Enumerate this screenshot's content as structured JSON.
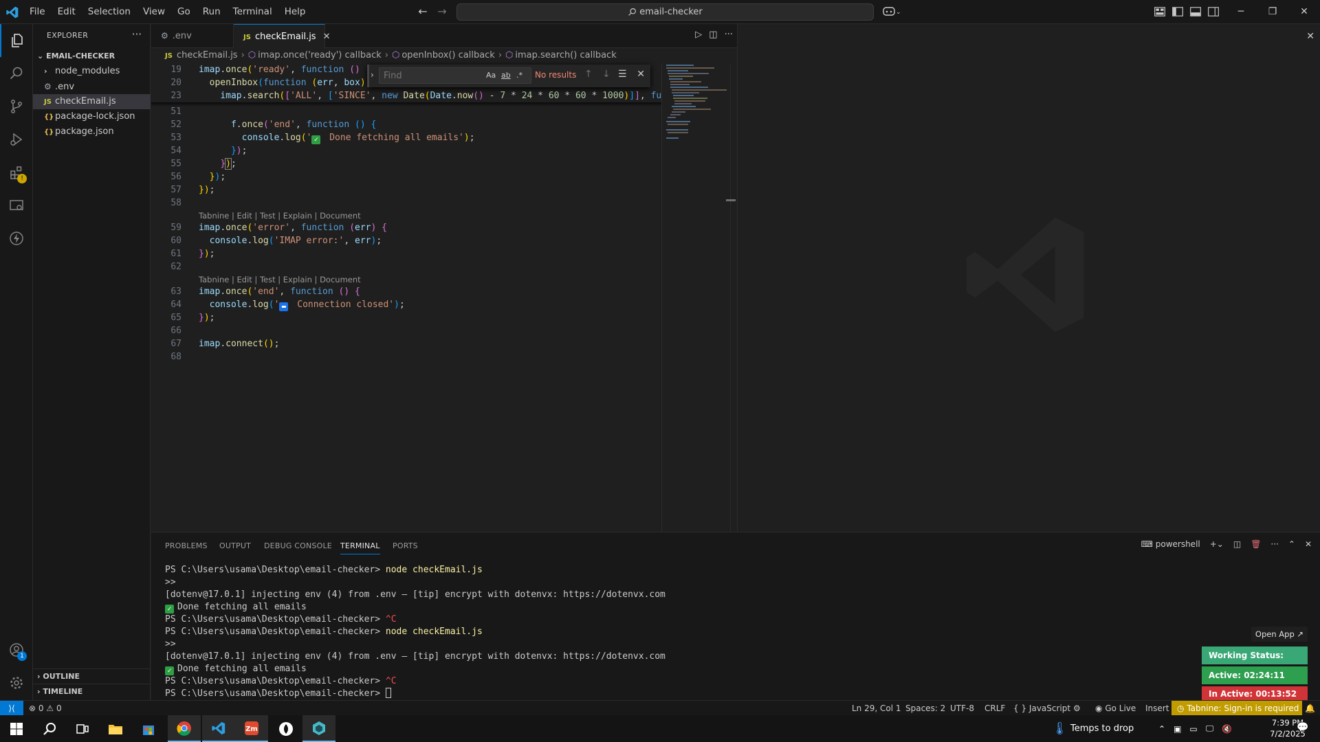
{
  "titlebar": {
    "menu": [
      "File",
      "Edit",
      "Selection",
      "View",
      "Go",
      "Run",
      "Terminal",
      "Help"
    ],
    "search_text": "email-checker"
  },
  "sidebar": {
    "title": "EXPLORER",
    "folder": "EMAIL-CHECKER",
    "items": [
      {
        "label": "node_modules",
        "type": "folder"
      },
      {
        "label": ".env",
        "type": "env"
      },
      {
        "label": "checkEmail.js",
        "type": "js"
      },
      {
        "label": "package-lock.json",
        "type": "json"
      },
      {
        "label": "package.json",
        "type": "json"
      }
    ],
    "outline": "OUTLINE",
    "timeline": "TIMELINE"
  },
  "tabs": [
    {
      "label": ".env",
      "icon": "gear-icon"
    },
    {
      "label": "checkEmail.js",
      "icon": "JS"
    }
  ],
  "breadcrumb": [
    "checkEmail.js",
    "imap.once('ready') callback",
    "openInbox() callback",
    "imap.search() callback"
  ],
  "find": {
    "placeholder": "Find",
    "case_label": "Aa",
    "word_label": "ab",
    "regex_label": ".*",
    "result": "No results"
  },
  "editor": {
    "sticky_numbers": [
      "19",
      "20",
      "23"
    ],
    "line_numbers": [
      "51",
      "52",
      "53",
      "54",
      "55",
      "56",
      "57",
      "58",
      "59",
      "60",
      "61",
      "62",
      "63",
      "64",
      "65",
      "66",
      "67",
      "68"
    ],
    "codelens": "Tabnine | Edit | Test | Explain | Document",
    "strings": {
      "ready": "'ready'",
      "all": "'ALL'",
      "since": "'SINCE'",
      "end": "'end'",
      "done": " Done fetching all emails'",
      "error": "'error'",
      "imap_error": "'IMAP error:'",
      "closed": " Connection closed'"
    },
    "numbers": [
      "7",
      "24",
      "60",
      "60",
      "1000"
    ]
  },
  "panel": {
    "tabs": [
      "PROBLEMS",
      "OUTPUT",
      "DEBUG CONSOLE",
      "TERMINAL",
      "PORTS"
    ],
    "shell": "powershell",
    "terminal": [
      {
        "prompt": "PS C:\\Users\\usama\\Desktop\\email-checker> ",
        "cmd": "node checkEmail.js"
      },
      {
        "text": ">>"
      },
      {
        "text": "[dotenv@17.0.1] injecting env (4) from .env – [tip] encrypt with dotenvx: https://dotenvx.com"
      },
      {
        "check": "Done fetching all emails"
      },
      {
        "prompt": "PS C:\\Users\\usama\\Desktop\\email-checker> ",
        "ctrl": "^C"
      },
      {
        "prompt": "PS C:\\Users\\usama\\Desktop\\email-checker> ",
        "cmd": "node checkEmail.js"
      },
      {
        "text": ">>"
      },
      {
        "text": "[dotenv@17.0.1] injecting env (4) from .env – [tip] encrypt with dotenvx: https://dotenvx.com"
      },
      {
        "check": "Done fetching all emails"
      },
      {
        "prompt": "PS C:\\Users\\usama\\Desktop\\email-checker> ",
        "ctrl": "^C"
      },
      {
        "prompt": "PS C:\\Users\\usama\\Desktop\\email-checker> ",
        "cursor": true
      }
    ]
  },
  "widget": {
    "open_app": "Open App ↗",
    "working_status": "Working Status: Active",
    "active": "Active: 02:24:11",
    "inactive": "In Active: 00:13:52",
    "colors": {
      "status": "#3aa876",
      "active": "#2e9e4f",
      "inactive": "#d13438"
    }
  },
  "statusbar": {
    "errors": "0",
    "warnings": "0",
    "position": "Ln 29, Col 1",
    "spaces": "Spaces: 2",
    "encoding": "UTF-8",
    "eol": "CRLF",
    "language": "JavaScript",
    "golive": "Go Live",
    "insert": "Insert",
    "tabnine": "Tabnine: Sign-in is required"
  },
  "taskbar": {
    "weather": "Temps to drop",
    "time": "7:39 PM",
    "date": "7/2/2025"
  },
  "badges": {
    "extensions_badge": "!",
    "account_badge": "1"
  }
}
